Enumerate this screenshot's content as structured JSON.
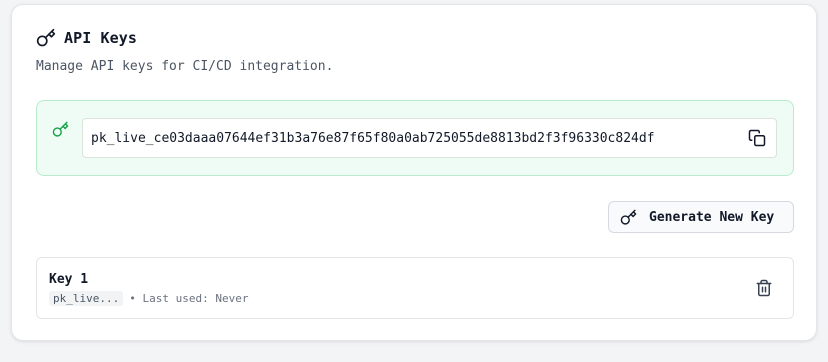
{
  "header": {
    "title": "API Keys",
    "subtitle": "Manage API keys for CI/CD integration."
  },
  "new_key": {
    "value": "pk_live_ce03daaa07644ef31b3a76e87f65f80a0ab725055de8813bd2f3f96330c824df",
    "copy_icon": "copy-icon",
    "accent": "#16a34a"
  },
  "actions": {
    "generate_label": "Generate New Key"
  },
  "keys": [
    {
      "name": "Key 1",
      "prefix": "pk_live...",
      "last_used": "• Last used: Never"
    }
  ],
  "colors": {
    "success_bg": "#effcf5",
    "success_border": "#b8ebcc",
    "card_border": "#e3e5e9"
  }
}
